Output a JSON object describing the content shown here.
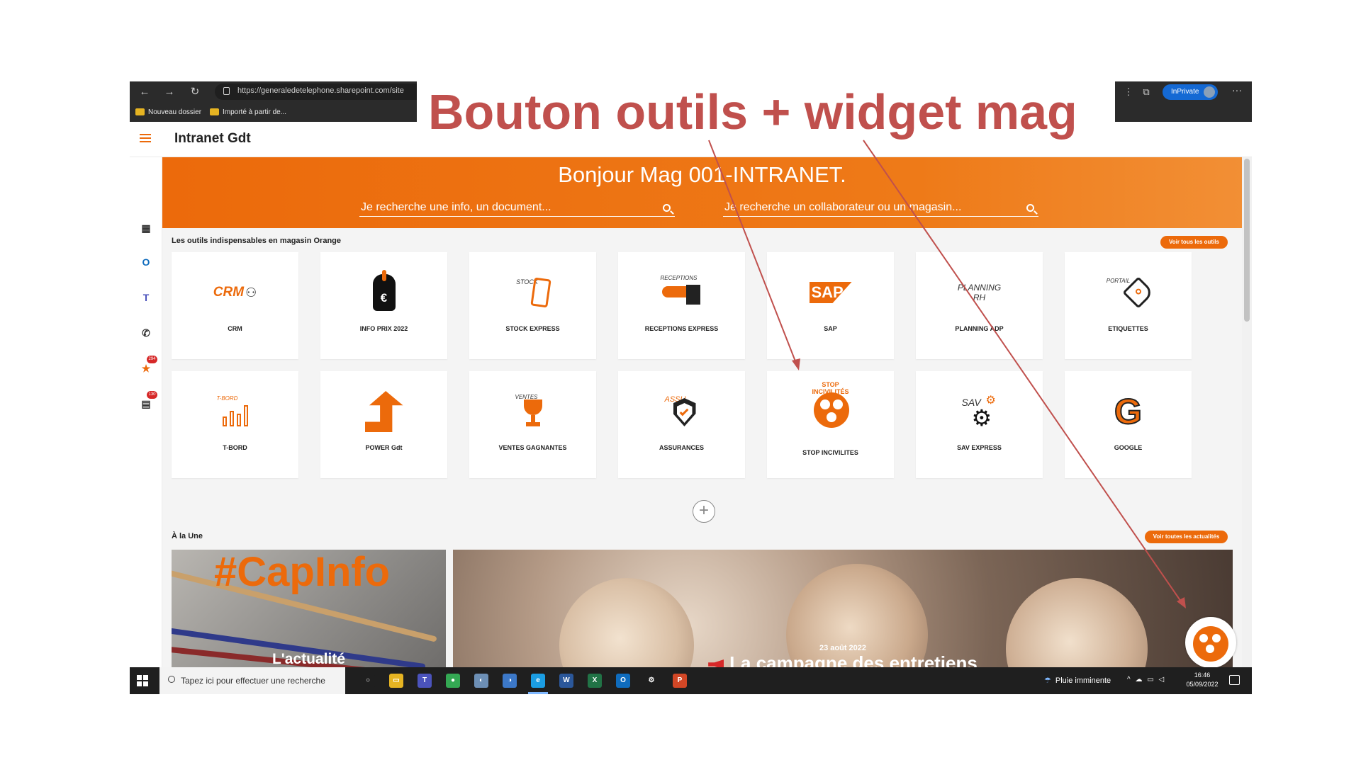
{
  "annotation": {
    "title": "Bouton outils + widget mag",
    "arrow_color": "#c0504d"
  },
  "browser": {
    "url": "https://generaledetelephone.sharepoint.com/site",
    "bookmarks": [
      "Nouveau dossier",
      "Importé à partir de..."
    ],
    "inprivate_label": "InPrivate",
    "more_label": "···"
  },
  "site": {
    "title": "Intranet Gdt"
  },
  "rail": {
    "items": [
      {
        "name": "apps-icon",
        "glyph": "▦"
      },
      {
        "name": "outlook-icon",
        "glyph": "O",
        "color": "#0f6cbd"
      },
      {
        "name": "teams-icon",
        "glyph": "T",
        "color": "#4b53bc"
      },
      {
        "name": "phone-icon",
        "glyph": "✆"
      },
      {
        "name": "bookmark-icon",
        "glyph": "★",
        "color": "#ec6a0b",
        "badge": "294"
      },
      {
        "name": "news-icon",
        "glyph": "▤",
        "badge": "130"
      }
    ]
  },
  "hero": {
    "greeting": "Bonjour Mag 001-INTRANET.",
    "search_doc_placeholder": "Je recherche une info, un document...",
    "search_people_placeholder": "Je recherche un collaborateur ou un magasin..."
  },
  "tools": {
    "section_title": "Les outils indispensables en magasin Orange",
    "view_all": "Voir tous les outils",
    "items": [
      {
        "label": "CRM",
        "icon_text": "CRM",
        "icon": "crm-icon"
      },
      {
        "label": "INFO PRIX 2022",
        "icon_text": "€",
        "icon": "price-tag-icon"
      },
      {
        "label": "STOCK EXPRESS",
        "icon_text": "STOCK",
        "icon": "stock-icon"
      },
      {
        "label": "RECEPTIONS EXPRESS",
        "icon_text": "RECEPTIONS",
        "icon": "receptions-icon"
      },
      {
        "label": "SAP",
        "icon_text": "SAP",
        "icon": "sap-icon"
      },
      {
        "label": "PLANNING ADP",
        "icon_text": "PLANNING RH",
        "icon": "planning-icon"
      },
      {
        "label": "ETIQUETTES",
        "icon_text": "PORTAIL",
        "icon": "label-icon"
      },
      {
        "label": "T-BORD",
        "icon_text": "T-BORD",
        "icon": "dashboard-icon"
      },
      {
        "label": "POWER Gdt",
        "icon_text": "",
        "icon": "growth-arrow-icon"
      },
      {
        "label": "VENTES GAGNANTES",
        "icon_text": "VENTES",
        "icon": "trophy-icon"
      },
      {
        "label": "ASSURANCES",
        "icon_text": "ASSU",
        "icon": "shield-icon"
      },
      {
        "label": "STOP INCIVILITES",
        "icon_text": "STOP INCIVILITÉS",
        "icon": "stop-incivilites-icon"
      },
      {
        "label": "SAV EXPRESS",
        "icon_text": "SAV",
        "icon": "gear-icon"
      },
      {
        "label": "GOOGLE",
        "icon_text": "G",
        "icon": "google-icon"
      }
    ]
  },
  "news": {
    "section_title": "À la Une",
    "view_all": "Voir toutes les actualités",
    "cards": [
      {
        "tag": "#CapInfo",
        "title": "L'actualité"
      },
      {
        "date": "23 août 2022",
        "title": "La campagne des entretiens"
      }
    ]
  },
  "taskbar": {
    "search_placeholder": "Tapez ici pour effectuer une recherche",
    "weather": "Pluie imminente",
    "time": "16:46",
    "date": "05/09/2022",
    "apps": [
      {
        "name": "task-view-icon",
        "glyph": "○",
        "color": "#1f1f1f"
      },
      {
        "name": "file-explorer-icon",
        "glyph": "▭",
        "color": "#e6b422"
      },
      {
        "name": "teams-app-icon",
        "glyph": "T",
        "color": "#4b53bc"
      },
      {
        "name": "chrome-icon",
        "glyph": "●",
        "color": "#34a853"
      },
      {
        "name": "app-icon-5",
        "glyph": "◐",
        "color": "#6d8fb5"
      },
      {
        "name": "app-icon-6",
        "glyph": "◑",
        "color": "#3c78c8"
      },
      {
        "name": "edge-icon",
        "glyph": "e",
        "color": "#1b9de2"
      },
      {
        "name": "word-icon",
        "glyph": "W",
        "color": "#2b579a"
      },
      {
        "name": "excel-icon",
        "glyph": "X",
        "color": "#217346"
      },
      {
        "name": "outlook-app-icon",
        "glyph": "O",
        "color": "#0f6cbd"
      },
      {
        "name": "settings-icon",
        "glyph": "⚙",
        "color": "#1f1f1f"
      },
      {
        "name": "powerpoint-icon",
        "glyph": "P",
        "color": "#d24726"
      }
    ]
  },
  "colors": {
    "brand_orange": "#ec6a0b",
    "annotation_red": "#c0504d"
  }
}
